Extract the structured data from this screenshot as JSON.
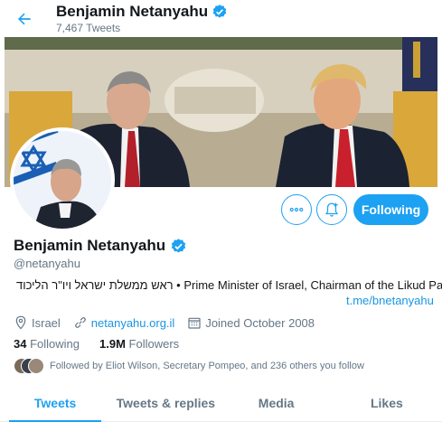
{
  "header": {
    "name": "Benjamin Netanyahu",
    "tweet_count": "7,467 Tweets"
  },
  "profile": {
    "name": "Benjamin Netanyahu",
    "handle": "@netanyahu",
    "bio": "ראש ממשלת ישראל ויו\"ר הליכוד • Prime Minister of Israel, Chairman of the Likud Party",
    "bio_link": "t.me/bnetanyahu",
    "location": "Israel",
    "website": "netanyahu.org.il",
    "joined": "Joined October 2008",
    "following_count": "34",
    "following_label": "Following",
    "followers_count": "1.9M",
    "followers_label": "Followers",
    "followed_by": "Followed by Eliot Wilson, Secretary Pompeo, and 236 others you follow"
  },
  "actions": {
    "follow_label": "Following"
  },
  "tabs": [
    {
      "label": "Tweets",
      "active": true
    },
    {
      "label": "Tweets & replies",
      "active": false
    },
    {
      "label": "Media",
      "active": false
    },
    {
      "label": "Likes",
      "active": false
    }
  ],
  "icons": [
    "back-arrow-icon",
    "verified-badge-icon",
    "more-icon",
    "notification-bell-icon",
    "location-icon",
    "link-icon",
    "calendar-icon"
  ],
  "colors": {
    "accent": "#1da1f2",
    "link": "#1b95e0",
    "secondary_text": "#657786",
    "primary_text": "#14171a"
  }
}
